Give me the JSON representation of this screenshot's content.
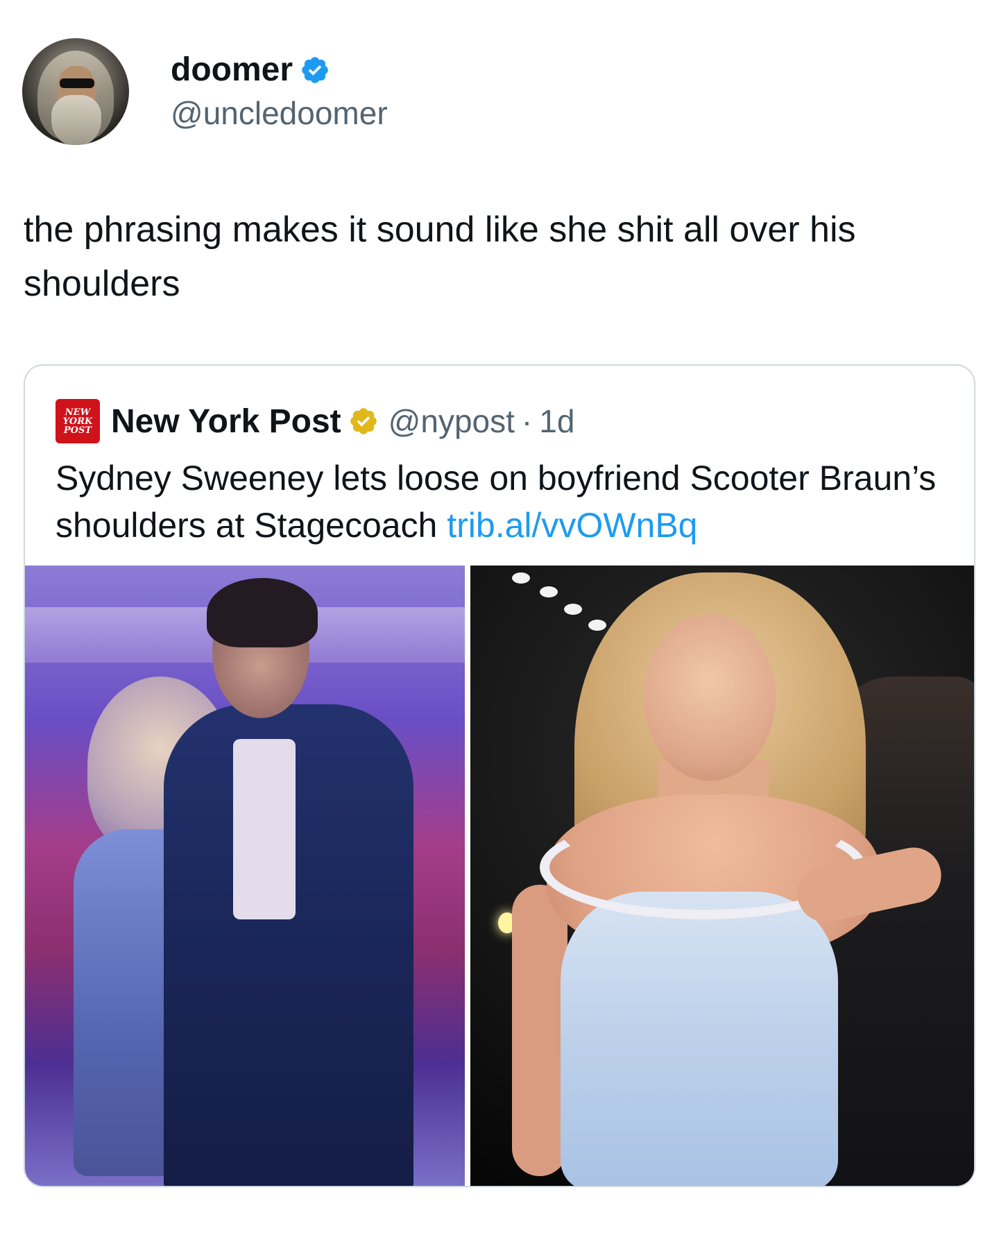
{
  "author": {
    "display_name": "doomer",
    "handle": "@uncledoomer",
    "verified": true,
    "avatar_icon": "wizard-avatar"
  },
  "tweet": {
    "text": "the phrasing makes it sound like she shit all over his shoulders"
  },
  "quote": {
    "logo_lines": [
      "NEW",
      "YORK",
      "POST"
    ],
    "display_name": "New York Post",
    "badge": "gold-verified-icon",
    "handle": "@nypost",
    "separator": "·",
    "time": "1d",
    "text": "Sydney Sweeney lets loose on boyfriend Scooter Braun’s shoulders at Stagecoach ",
    "link": "trib.al/vvOWnBq"
  },
  "colors": {
    "text": "#0f1419",
    "secondary": "#536471",
    "link": "#1d9bf0",
    "verified_blue": "#1d9bf0",
    "verified_gold": "#e2b719",
    "nyp_red": "#d0121b",
    "border": "#cfd9de"
  }
}
